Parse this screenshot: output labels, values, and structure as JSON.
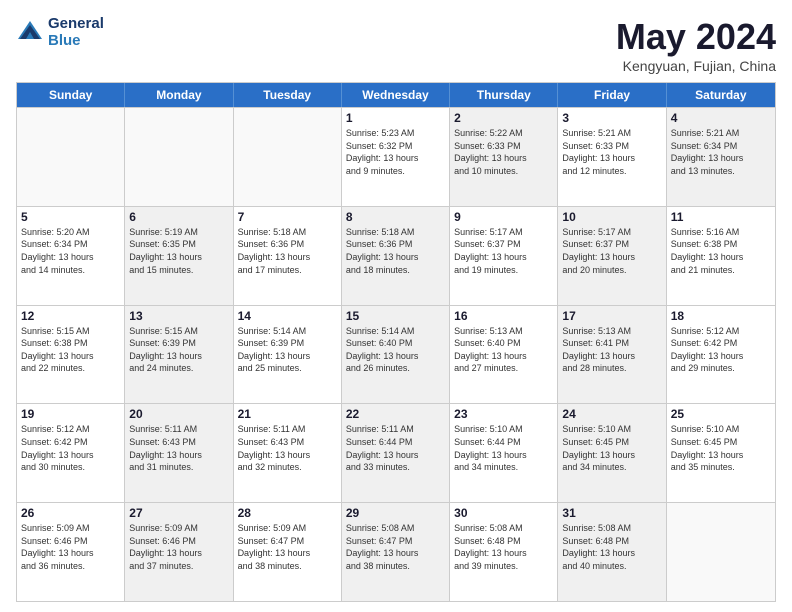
{
  "header": {
    "logo_line1": "General",
    "logo_line2": "Blue",
    "main_title": "May 2024",
    "subtitle": "Kengyuan, Fujian, China"
  },
  "weekdays": [
    "Sunday",
    "Monday",
    "Tuesday",
    "Wednesday",
    "Thursday",
    "Friday",
    "Saturday"
  ],
  "rows": [
    [
      {
        "day": "",
        "info": "",
        "shaded": false,
        "empty": true
      },
      {
        "day": "",
        "info": "",
        "shaded": false,
        "empty": true
      },
      {
        "day": "",
        "info": "",
        "shaded": false,
        "empty": true
      },
      {
        "day": "1",
        "info": "Sunrise: 5:23 AM\nSunset: 6:32 PM\nDaylight: 13 hours\nand 9 minutes.",
        "shaded": false,
        "empty": false
      },
      {
        "day": "2",
        "info": "Sunrise: 5:22 AM\nSunset: 6:33 PM\nDaylight: 13 hours\nand 10 minutes.",
        "shaded": true,
        "empty": false
      },
      {
        "day": "3",
        "info": "Sunrise: 5:21 AM\nSunset: 6:33 PM\nDaylight: 13 hours\nand 12 minutes.",
        "shaded": false,
        "empty": false
      },
      {
        "day": "4",
        "info": "Sunrise: 5:21 AM\nSunset: 6:34 PM\nDaylight: 13 hours\nand 13 minutes.",
        "shaded": true,
        "empty": false
      }
    ],
    [
      {
        "day": "5",
        "info": "Sunrise: 5:20 AM\nSunset: 6:34 PM\nDaylight: 13 hours\nand 14 minutes.",
        "shaded": false,
        "empty": false
      },
      {
        "day": "6",
        "info": "Sunrise: 5:19 AM\nSunset: 6:35 PM\nDaylight: 13 hours\nand 15 minutes.",
        "shaded": true,
        "empty": false
      },
      {
        "day": "7",
        "info": "Sunrise: 5:18 AM\nSunset: 6:36 PM\nDaylight: 13 hours\nand 17 minutes.",
        "shaded": false,
        "empty": false
      },
      {
        "day": "8",
        "info": "Sunrise: 5:18 AM\nSunset: 6:36 PM\nDaylight: 13 hours\nand 18 minutes.",
        "shaded": true,
        "empty": false
      },
      {
        "day": "9",
        "info": "Sunrise: 5:17 AM\nSunset: 6:37 PM\nDaylight: 13 hours\nand 19 minutes.",
        "shaded": false,
        "empty": false
      },
      {
        "day": "10",
        "info": "Sunrise: 5:17 AM\nSunset: 6:37 PM\nDaylight: 13 hours\nand 20 minutes.",
        "shaded": true,
        "empty": false
      },
      {
        "day": "11",
        "info": "Sunrise: 5:16 AM\nSunset: 6:38 PM\nDaylight: 13 hours\nand 21 minutes.",
        "shaded": false,
        "empty": false
      }
    ],
    [
      {
        "day": "12",
        "info": "Sunrise: 5:15 AM\nSunset: 6:38 PM\nDaylight: 13 hours\nand 22 minutes.",
        "shaded": false,
        "empty": false
      },
      {
        "day": "13",
        "info": "Sunrise: 5:15 AM\nSunset: 6:39 PM\nDaylight: 13 hours\nand 24 minutes.",
        "shaded": true,
        "empty": false
      },
      {
        "day": "14",
        "info": "Sunrise: 5:14 AM\nSunset: 6:39 PM\nDaylight: 13 hours\nand 25 minutes.",
        "shaded": false,
        "empty": false
      },
      {
        "day": "15",
        "info": "Sunrise: 5:14 AM\nSunset: 6:40 PM\nDaylight: 13 hours\nand 26 minutes.",
        "shaded": true,
        "empty": false
      },
      {
        "day": "16",
        "info": "Sunrise: 5:13 AM\nSunset: 6:40 PM\nDaylight: 13 hours\nand 27 minutes.",
        "shaded": false,
        "empty": false
      },
      {
        "day": "17",
        "info": "Sunrise: 5:13 AM\nSunset: 6:41 PM\nDaylight: 13 hours\nand 28 minutes.",
        "shaded": true,
        "empty": false
      },
      {
        "day": "18",
        "info": "Sunrise: 5:12 AM\nSunset: 6:42 PM\nDaylight: 13 hours\nand 29 minutes.",
        "shaded": false,
        "empty": false
      }
    ],
    [
      {
        "day": "19",
        "info": "Sunrise: 5:12 AM\nSunset: 6:42 PM\nDaylight: 13 hours\nand 30 minutes.",
        "shaded": false,
        "empty": false
      },
      {
        "day": "20",
        "info": "Sunrise: 5:11 AM\nSunset: 6:43 PM\nDaylight: 13 hours\nand 31 minutes.",
        "shaded": true,
        "empty": false
      },
      {
        "day": "21",
        "info": "Sunrise: 5:11 AM\nSunset: 6:43 PM\nDaylight: 13 hours\nand 32 minutes.",
        "shaded": false,
        "empty": false
      },
      {
        "day": "22",
        "info": "Sunrise: 5:11 AM\nSunset: 6:44 PM\nDaylight: 13 hours\nand 33 minutes.",
        "shaded": true,
        "empty": false
      },
      {
        "day": "23",
        "info": "Sunrise: 5:10 AM\nSunset: 6:44 PM\nDaylight: 13 hours\nand 34 minutes.",
        "shaded": false,
        "empty": false
      },
      {
        "day": "24",
        "info": "Sunrise: 5:10 AM\nSunset: 6:45 PM\nDaylight: 13 hours\nand 34 minutes.",
        "shaded": true,
        "empty": false
      },
      {
        "day": "25",
        "info": "Sunrise: 5:10 AM\nSunset: 6:45 PM\nDaylight: 13 hours\nand 35 minutes.",
        "shaded": false,
        "empty": false
      }
    ],
    [
      {
        "day": "26",
        "info": "Sunrise: 5:09 AM\nSunset: 6:46 PM\nDaylight: 13 hours\nand 36 minutes.",
        "shaded": false,
        "empty": false
      },
      {
        "day": "27",
        "info": "Sunrise: 5:09 AM\nSunset: 6:46 PM\nDaylight: 13 hours\nand 37 minutes.",
        "shaded": true,
        "empty": false
      },
      {
        "day": "28",
        "info": "Sunrise: 5:09 AM\nSunset: 6:47 PM\nDaylight: 13 hours\nand 38 minutes.",
        "shaded": false,
        "empty": false
      },
      {
        "day": "29",
        "info": "Sunrise: 5:08 AM\nSunset: 6:47 PM\nDaylight: 13 hours\nand 38 minutes.",
        "shaded": true,
        "empty": false
      },
      {
        "day": "30",
        "info": "Sunrise: 5:08 AM\nSunset: 6:48 PM\nDaylight: 13 hours\nand 39 minutes.",
        "shaded": false,
        "empty": false
      },
      {
        "day": "31",
        "info": "Sunrise: 5:08 AM\nSunset: 6:48 PM\nDaylight: 13 hours\nand 40 minutes.",
        "shaded": true,
        "empty": false
      },
      {
        "day": "",
        "info": "",
        "shaded": false,
        "empty": true
      }
    ]
  ]
}
